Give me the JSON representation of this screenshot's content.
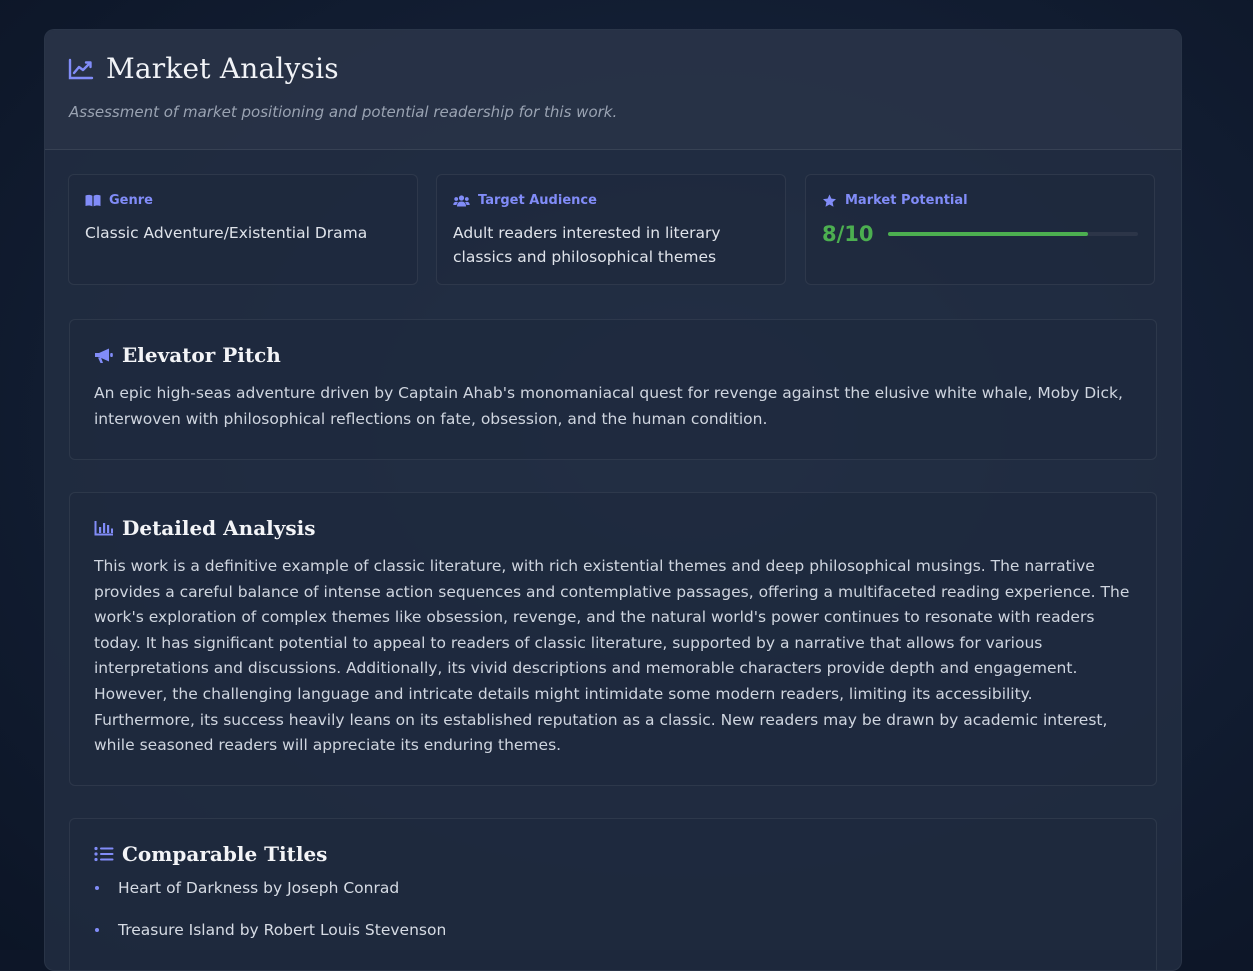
{
  "header": {
    "title": "Market Analysis",
    "subtitle": "Assessment of market positioning and potential readership for this work."
  },
  "stats": {
    "genre": {
      "label": "Genre",
      "value": "Classic Adventure/Existential Drama"
    },
    "audience": {
      "label": "Target Audience",
      "value": "Adult readers interested in literary classics and philosophical themes"
    },
    "potential": {
      "label": "Market Potential",
      "score_text": "8/10",
      "score": 8,
      "max": 10
    }
  },
  "elevator": {
    "title": "Elevator Pitch",
    "body": "An epic high-seas adventure driven by Captain Ahab's monomaniacal quest for revenge against the elusive white whale, Moby Dick, interwoven with philosophical reflections on fate, obsession, and the human condition."
  },
  "analysis": {
    "title": "Detailed Analysis",
    "body": "This work is a definitive example of classic literature, with rich existential themes and deep philosophical musings. The narrative provides a careful balance of intense action sequences and contemplative passages, offering a multifaceted reading experience. The work's exploration of complex themes like obsession, revenge, and the natural world's power continues to resonate with readers today. It has significant potential to appeal to readers of classic literature, supported by a narrative that allows for various interpretations and discussions. Additionally, its vivid descriptions and memorable characters provide depth and engagement. However, the challenging language and intricate details might intimidate some modern readers, limiting its accessibility. Furthermore, its success heavily leans on its established reputation as a classic. New readers may be drawn by academic interest, while seasoned readers will appreciate its enduring themes."
  },
  "comparables": {
    "title": "Comparable Titles",
    "items": [
      "Heart of Darkness by Joseph Conrad",
      "Treasure Island by Robert Louis Stevenson"
    ]
  },
  "colors": {
    "accent": "#818cf8",
    "success": "#4caf50"
  },
  "icons": {
    "title": "chart-line-icon",
    "genre": "book-open-icon",
    "audience": "users-icon",
    "potential": "star-icon",
    "elevator": "megaphone-icon",
    "analysis": "bar-chart-icon",
    "comparables": "list-icon"
  }
}
